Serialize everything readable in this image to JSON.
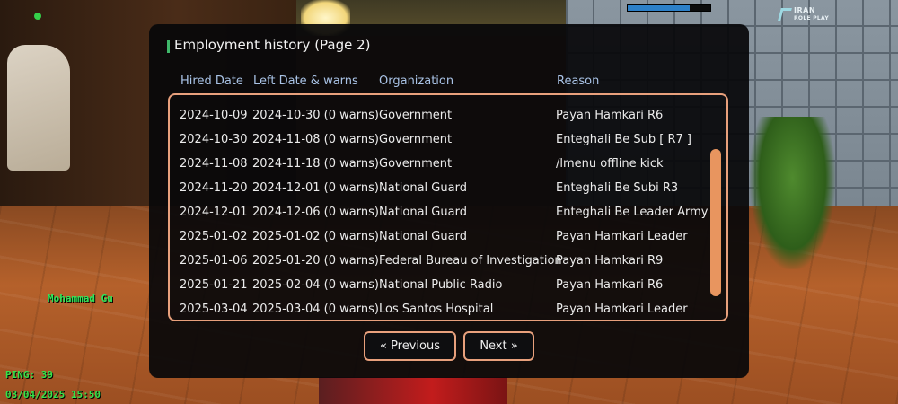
{
  "hud": {
    "player_name": "Mohammad Gu",
    "ping": "PING: 39",
    "datetime": "03/04/2025 15:50",
    "logo_line1": "IRAN",
    "logo_line2": "ROLE PLAY",
    "health_fraction": 0.75,
    "status_dot_color": "#35d04a",
    "bar_color": "#2d80c8"
  },
  "dialog": {
    "title": "Employment history (Page 2)",
    "columns": {
      "hired": "Hired Date",
      "left": "Left Date & warns",
      "organization": "Organization",
      "reason": "Reason"
    },
    "rows": [
      {
        "hired": "2024-10-09",
        "left": "2024-10-30 (0 warns)",
        "organization": "Government",
        "reason": "Payan Hamkari R6"
      },
      {
        "hired": "2024-10-30",
        "left": "2024-11-08 (0 warns)",
        "organization": "Government",
        "reason": "Enteghali Be Sub [ R7 ]"
      },
      {
        "hired": "2024-11-08",
        "left": "2024-11-18 (0 warns)",
        "organization": "Government",
        "reason": "/lmenu offline kick"
      },
      {
        "hired": "2024-11-20",
        "left": "2024-12-01 (0 warns)",
        "organization": "National Guard",
        "reason": "Enteghali Be Subi R3"
      },
      {
        "hired": "2024-12-01",
        "left": "2024-12-06 (0 warns)",
        "organization": "National Guard",
        "reason": "Enteghali Be Leader Army"
      },
      {
        "hired": "2025-01-02",
        "left": "2025-01-02 (0 warns)",
        "organization": "National Guard",
        "reason": "Payan Hamkari Leader"
      },
      {
        "hired": "2025-01-06",
        "left": "2025-01-20 (0 warns)",
        "organization": "Federal Bureau of Investigation",
        "reason": "Payan Hamkari R9"
      },
      {
        "hired": "2025-01-21",
        "left": "2025-02-04 (0 warns)",
        "organization": "National Public Radio",
        "reason": "Payan Hamkari R6"
      },
      {
        "hired": "2025-03-04",
        "left": "2025-03-04 (0 warns)",
        "organization": "Los Santos Hospital",
        "reason": "Payan Hamkari Leader"
      }
    ],
    "prev_label": "« Previous",
    "next_label": "Next »",
    "accent_color": "#e8a07c",
    "title_marker_color": "#3fb86a"
  }
}
